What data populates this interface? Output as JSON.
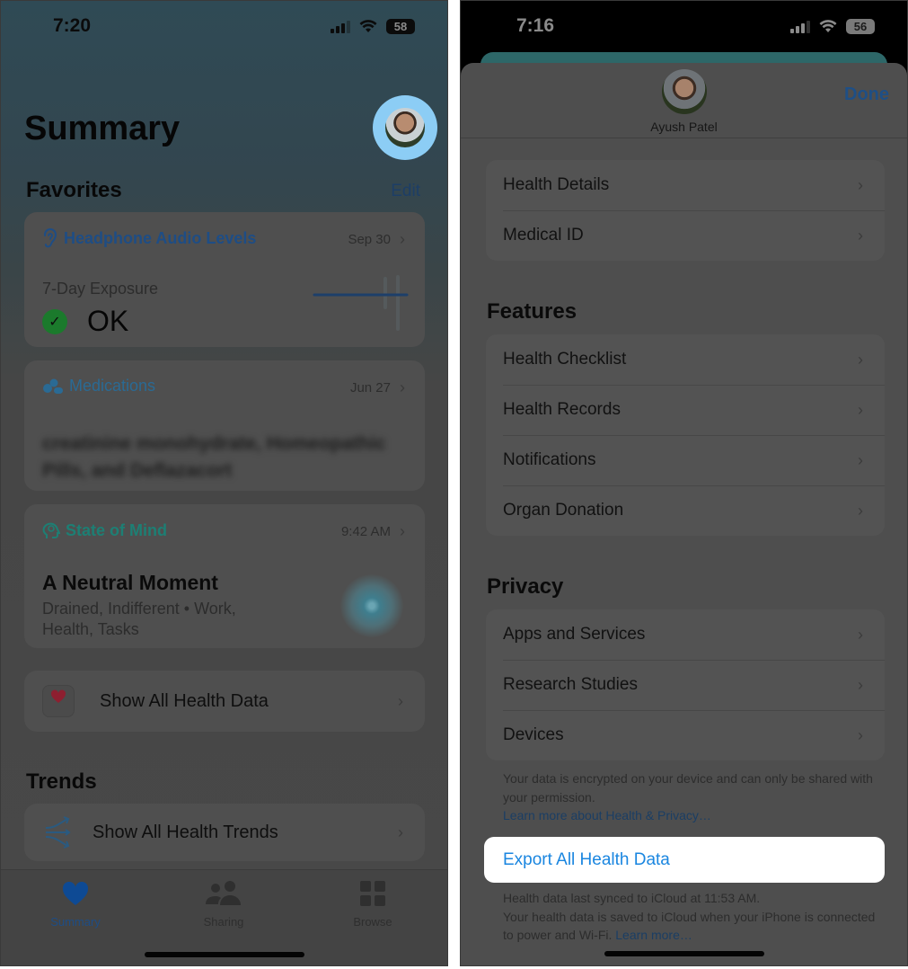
{
  "left_screen": {
    "status_bar": {
      "time": "7:20",
      "battery": "58"
    },
    "title": "Summary",
    "favorites_heading": "Favorites",
    "edit_label": "Edit",
    "cards": {
      "headphone": {
        "title": "Headphone Audio Levels",
        "date": "Sep 30",
        "metric_label": "7-Day Exposure",
        "metric_value": "OK",
        "accent": "#1e4d85"
      },
      "medications": {
        "title": "Medications",
        "date": "Jun 27",
        "body": "creatinine monohydrate, Homeopathic Pills, and Deflazacort",
        "accent": "#2a6a94"
      },
      "state_of_mind": {
        "title": "State of Mind",
        "time": "9:42 AM",
        "heading": "A Neutral Moment",
        "details": "Drained, Indifferent • Work, Health, Tasks",
        "accent": "#1d7f74"
      }
    },
    "show_all_health_data": "Show All Health Data",
    "trends_heading": "Trends",
    "show_all_health_trends": "Show All Health Trends",
    "tab_bar": [
      {
        "label": "Summary",
        "icon": "heart-icon",
        "active": true
      },
      {
        "label": "Sharing",
        "icon": "people-icon",
        "active": false
      },
      {
        "label": "Browse",
        "icon": "grid-icon",
        "active": false
      }
    ]
  },
  "right_screen": {
    "status_bar": {
      "time": "7:16",
      "battery": "56"
    },
    "profile_name": "Ayush Patel",
    "done_label": "Done",
    "profile_group": [
      "Health Details",
      "Medical ID"
    ],
    "features_heading": "Features",
    "features": [
      "Health Checklist",
      "Health Records",
      "Notifications",
      "Organ Donation"
    ],
    "privacy_heading": "Privacy",
    "privacy": [
      "Apps and Services",
      "Research Studies",
      "Devices"
    ],
    "privacy_footnote": "Your data is encrypted on your device and can only be shared with your permission.",
    "privacy_link": "Learn more about Health & Privacy…",
    "export_label": "Export All Health Data",
    "sync_footnote_1": "Health data last synced to iCloud at 11:53 AM.",
    "sync_footnote_2": "Your health data is saved to iCloud when your iPhone is connected to power and Wi-Fi.",
    "sync_link": "Learn more…",
    "accent": "#1a86e0"
  }
}
